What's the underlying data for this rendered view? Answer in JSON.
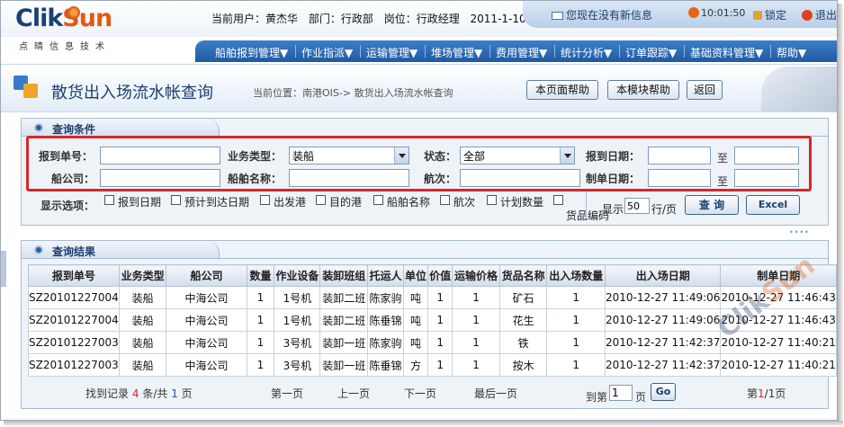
{
  "brand": {
    "logo_part1": "Clik",
    "logo_part2": "Sun",
    "logo_sub": "点晴信息技术"
  },
  "user": {
    "current_user": "当前用户：黄杰华",
    "department": "部门：行政部",
    "position": "岗位：行政经理",
    "date": "2011-1-10"
  },
  "header": {
    "message": "您现在没有新信息",
    "clock": "10:01:50",
    "lock_label": "锁定",
    "exit_label": "退出"
  },
  "nav": {
    "items": [
      "船舶报到管理▼",
      "作业指派▼",
      "运输管理▼",
      "堆场管理▼",
      "费用管理▼",
      "统计分析▼",
      "订单跟踪▼",
      "基础资料管理▼",
      "帮助▼"
    ]
  },
  "title": {
    "page_title": "散货出入场流水帐查询",
    "breadcrumb": "当前位置：南港OIS-> 散货出入场流水帐查询",
    "btn_page_help": "本页面帮助",
    "btn_module_help": "本模块帮助",
    "btn_back": "返回"
  },
  "query": {
    "panel_title": "查询条件",
    "labels": {
      "report_no": "报到单号：",
      "biz_type": "业务类型：",
      "status": "状态：",
      "report_date": "报到日期：",
      "ship_company": "船公司：",
      "ship_name": "船舶名称：",
      "voyage": "航次：",
      "doc_date": "制单日期：",
      "to": "至"
    },
    "values": {
      "biz_type": "装船",
      "status": "全部"
    },
    "display_options": {
      "label": "显示选项：",
      "items": [
        "报到日期",
        "预计到达日期",
        "出发港",
        "目的港",
        "船舶名称",
        "航次",
        "计划数量",
        "货品编码"
      ]
    },
    "page_size": {
      "prefix": "显示",
      "value": "50",
      "suffix": "行/页"
    },
    "btn_query": "查 询",
    "btn_excel": "Excel"
  },
  "results": {
    "panel_title": "查询结果",
    "columns": [
      "报到单号",
      "业务类型",
      "船公司",
      "数量",
      "作业设备",
      "装卸班组",
      "托运人",
      "单位",
      "价值",
      "运输价格",
      "货品名称",
      "出入场数量",
      "出入场日期",
      "制单日期"
    ],
    "rows": [
      [
        "SZ20101227004",
        "装船",
        "中海公司",
        "1",
        "1号机",
        "装卸二班",
        "陈家驹",
        "吨",
        "1",
        "1",
        "矿石",
        "1",
        "2010-12-27 11:49:06",
        "2010-12-27 11:46:43"
      ],
      [
        "SZ20101227004",
        "装船",
        "中海公司",
        "1",
        "1号机",
        "装卸二班",
        "陈垂锦",
        "吨",
        "1",
        "1",
        "花生",
        "1",
        "2010-12-27 11:49:06",
        "2010-12-27 11:46:43"
      ],
      [
        "SZ20101227003",
        "装船",
        "中海公司",
        "1",
        "3号机",
        "装卸一班",
        "陈家驹",
        "吨",
        "1",
        "1",
        "铁",
        "1",
        "2010-12-27 11:42:37",
        "2010-12-27 11:40:21"
      ],
      [
        "SZ20101227003",
        "装船",
        "中海公司",
        "1",
        "3号机",
        "装卸一班",
        "陈垂锦",
        "方",
        "1",
        "1",
        "按木",
        "1",
        "2010-12-27 11:42:37",
        "2010-12-27 11:40:21"
      ]
    ]
  },
  "pager": {
    "found_prefix": "找到记录",
    "record_count": "4",
    "found_mid": "条/共",
    "page_count": "1",
    "found_suffix": "页",
    "first": "第一页",
    "prev": "上一页",
    "next": "下一页",
    "last": "最后一页",
    "goto_prefix": "到第",
    "goto_value": "1",
    "goto_suffix": "页",
    "go": "Go",
    "current_prefix": "第",
    "current_page": "1",
    "current_mid": "/1",
    "current_suffix": "页"
  },
  "watermark": {
    "part1": "Clik",
    "part2": "Sun"
  }
}
